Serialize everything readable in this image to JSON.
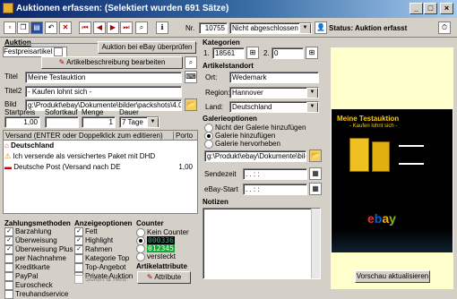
{
  "window": {
    "title": "Auktionen erfassen: (Selektiert wurden 691 Sätze)"
  },
  "toolbar": {
    "nr_label": "Nr.",
    "nr_value": "10755",
    "status_select": "Nicht abgeschlossen",
    "status_text": "Status: Auktion erfasst"
  },
  "auktion": {
    "heading": "Auktion",
    "festpreis_label": "Festpreisartikel",
    "ebay_check_button": "Auktion bei eBay überprüfen",
    "edit_desc_button": "Artikelbeschreibung bearbeiten",
    "titel_label": "Titel",
    "titel_value": "Meine Testauktion",
    "titel2_label": "Titel2",
    "titel2_value": "- Kaufen lohnt sich -",
    "bild_label": "Bild",
    "bild_value": "g:\\Produkt\\ebay\\Dokumente\\bilder\\packshots\\4.0\\ouf\\bank",
    "startpreis_label": "Startpreis",
    "startpreis_value": "1,00",
    "sofortkauf_label": "Sofortkauf",
    "sofortkauf_value": "",
    "menge_label": "Menge",
    "menge_value": "1",
    "dauer_label": "Dauer",
    "dauer_value": "7 Tage"
  },
  "versand": {
    "header": "Versand (ENTER oder Doppelklick zum editieren)",
    "porto_header": "Porto",
    "rows": [
      {
        "text": "Deutschland",
        "porto": "",
        "bold": true
      },
      {
        "text": "Ich versende als versichertes Paket mit DHD",
        "porto": ""
      },
      {
        "text": "Deutsche Post (Versand nach DE",
        "porto": "1,00"
      }
    ]
  },
  "kategorien": {
    "heading": "Kategorien",
    "k1_label": "1.",
    "k1_value": "18561",
    "k2_label": "2.",
    "k2_value": "0"
  },
  "standort": {
    "heading": "Artikelstandort",
    "ort_label": "Ort:",
    "ort_value": "Wedemark",
    "region_label": "Region:",
    "region_value": "Hannover",
    "land_label": "Land:",
    "land_value": "Deutschland"
  },
  "galerie": {
    "heading": "Galerieoptionen",
    "options": [
      "Nicht der Galerie hinzufügen",
      "Galerie hinzufügen",
      "Galerie hervorheben"
    ],
    "selected": 1,
    "path_value": "g:\\Produkt\\ebay\\Dokumente\\bilder\\pi"
  },
  "zeiten": {
    "sendezeit_label": "Sendezeit",
    "sendezeit_value": ". . : :",
    "ebay_start_label": "eBay-Start",
    "ebay_start_value": ". . : :"
  },
  "notizen": {
    "heading": "Notizen"
  },
  "zahlung": {
    "heading": "Zahlungsmethoden",
    "items": [
      {
        "label": "Barzahlung",
        "checked": true
      },
      {
        "label": "Überweisung",
        "checked": true
      },
      {
        "label": "Überweisung Plus",
        "checked": true
      },
      {
        "label": "per Nachnahme",
        "checked": false
      },
      {
        "label": "Kreditkarte",
        "checked": false
      },
      {
        "label": "PayPal",
        "checked": false
      },
      {
        "label": "Euroscheck",
        "checked": false
      },
      {
        "label": "Treuhandservice",
        "checked": false
      }
    ]
  },
  "anzeige": {
    "heading": "Anzeigeoptionen",
    "items": [
      {
        "label": "Fett",
        "checked": true
      },
      {
        "label": "Highlight",
        "checked": true
      },
      {
        "label": "Rahmen",
        "checked": true
      },
      {
        "label": "Kategorie Top",
        "checked": false
      },
      {
        "label": "Top-Angebot",
        "checked": false
      },
      {
        "label": "Private Auktion",
        "checked": false
      }
    ],
    "sofort_neu_label": "Sofort & Neu"
  },
  "counter": {
    "heading": "Counter",
    "kein_label": "Kein Counter",
    "c1_value": "000336",
    "c2_value": "012345",
    "versteckt_label": "versteckt"
  },
  "artikelattribute": {
    "heading": "Artikelattribute",
    "button": "Attribute"
  },
  "preview": {
    "title": "Meine Testauktion",
    "subtitle": "- Kaufen lohnt sich -",
    "ebay_logo": "ebay",
    "refresh_button": "Vorschau aktualisieren"
  },
  "colors": {
    "accent": "#0a246a",
    "preview_bg": "#000000",
    "window": "#d4d0c8"
  }
}
